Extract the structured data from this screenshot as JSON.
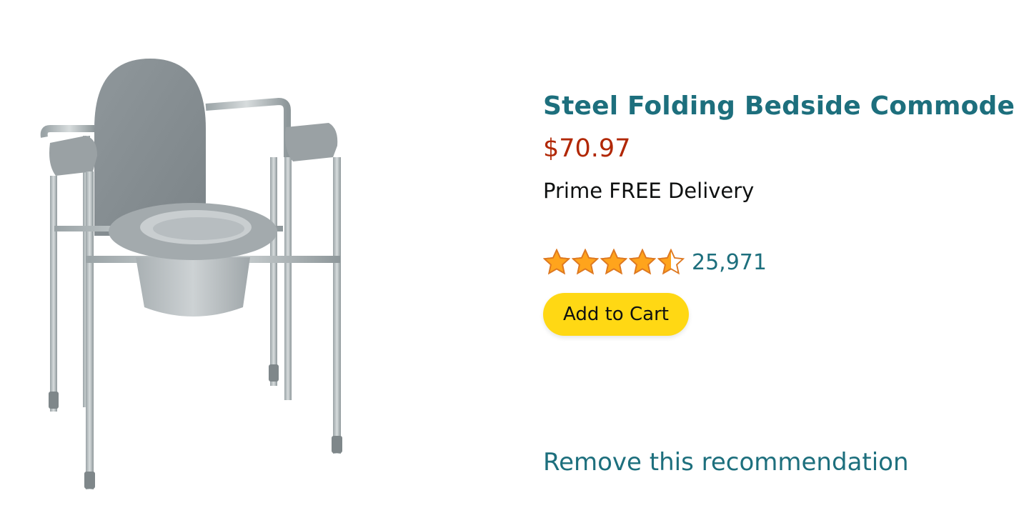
{
  "product": {
    "title": "Steel Folding Bedside Commode",
    "price": "$70.97",
    "delivery": "Prime FREE Delivery",
    "rating": 4.5,
    "rating_max": 5,
    "review_count": "25,971",
    "add_to_cart_label": "Add to Cart",
    "image_icon": "commode-chair-image"
  },
  "actions": {
    "remove_label": "Remove this recommendation"
  },
  "colors": {
    "title_link": "#1d6f7d",
    "price": "#b12704",
    "star": "#ffa41c",
    "star_outline": "#de7921",
    "button_bg": "#ffd814"
  }
}
